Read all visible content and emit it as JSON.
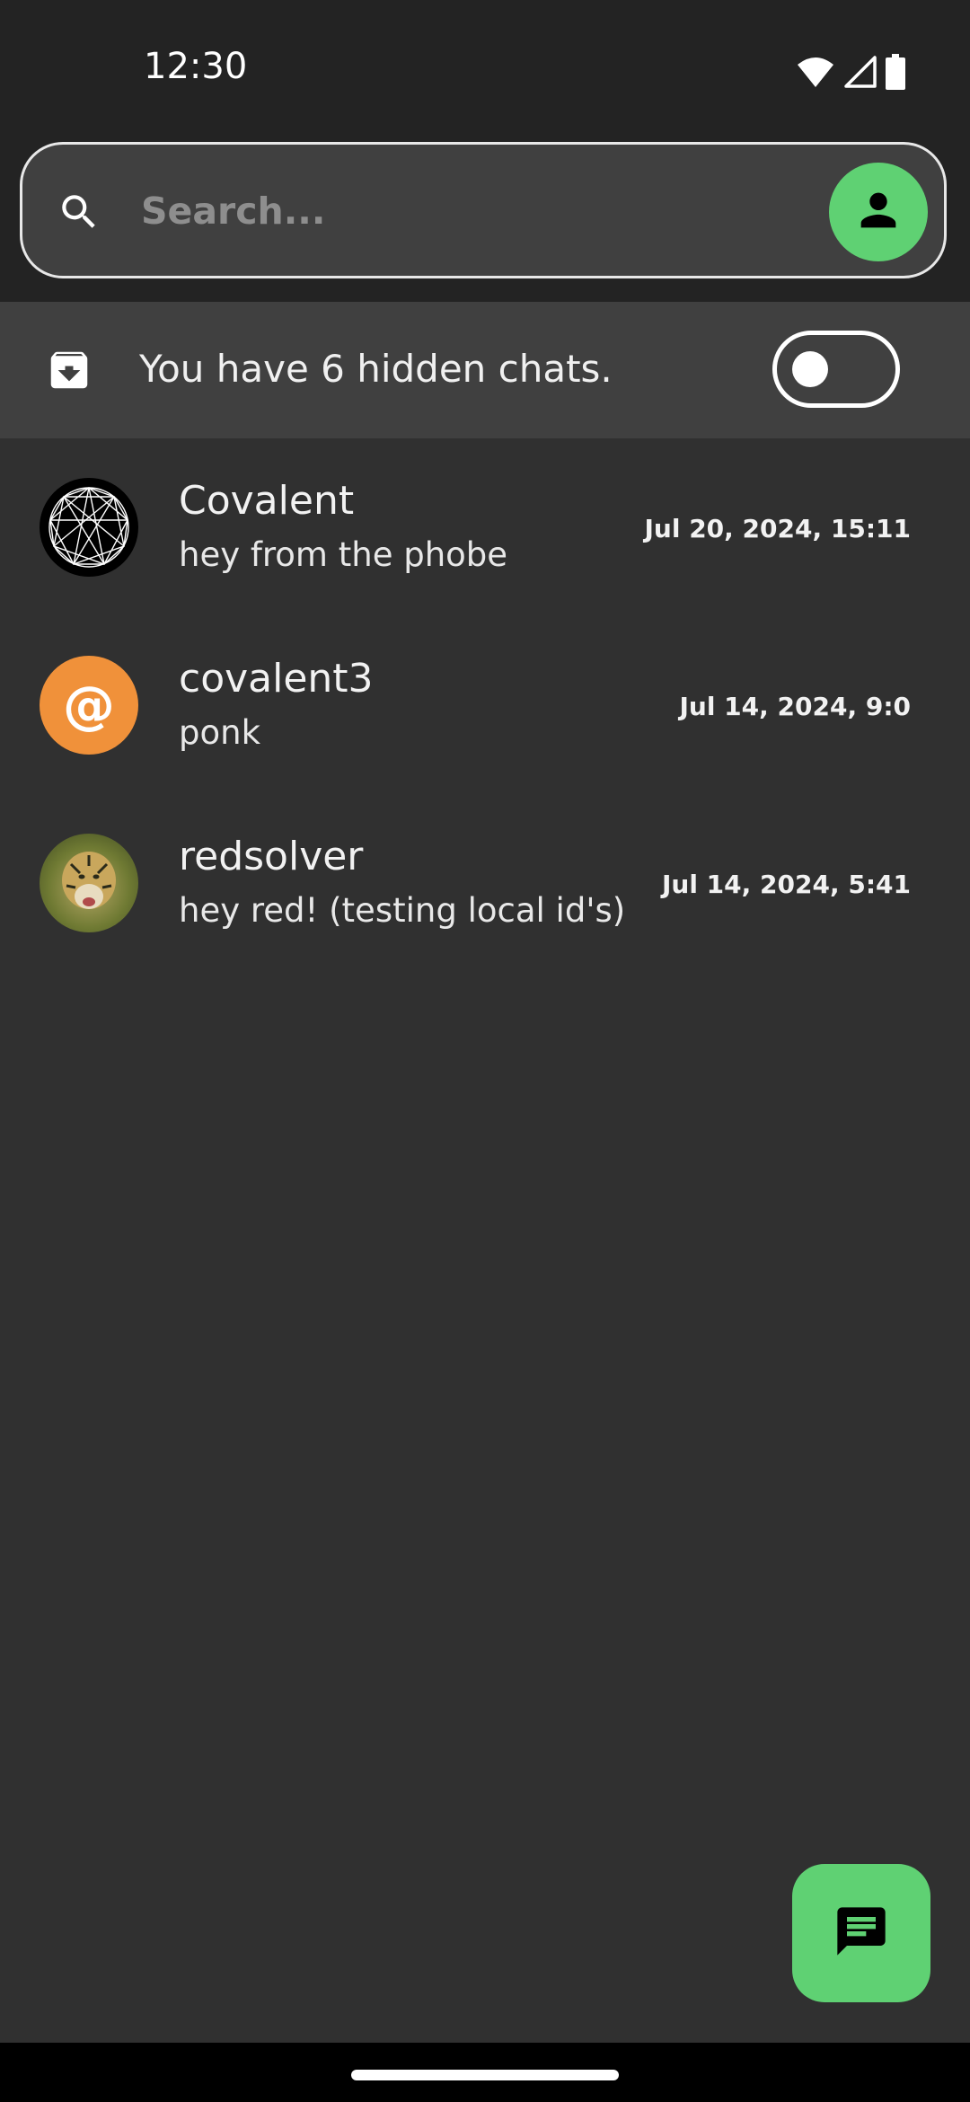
{
  "status_bar": {
    "time": "12:30",
    "icons": [
      "wifi-icon",
      "signal-icon",
      "battery-icon"
    ]
  },
  "search": {
    "placeholder": "Search...",
    "value": "",
    "icon": "search-icon",
    "profile_icon": "person-icon"
  },
  "hidden_chats": {
    "text": "You have 6 hidden chats.",
    "icon": "archive-icon",
    "toggle_on": false
  },
  "chats": [
    {
      "name": "Covalent",
      "message": "hey from the phobe",
      "time": "Jul 20, 2024, 15:11",
      "avatar": "network-graph-icon"
    },
    {
      "name": "covalent3",
      "message": "ponk",
      "time": "Jul 14, 2024, 9:0",
      "avatar": "at-sign",
      "avatar_text": "@"
    },
    {
      "name": "redsolver",
      "message": "hey red! (testing local id's)",
      "time": "Jul 14, 2024, 5:41",
      "avatar": "tiger-photo"
    }
  ],
  "fab": {
    "icon": "chat-icon"
  },
  "colors": {
    "accent": "#5fd173",
    "background": "#303030",
    "header": "#232323",
    "hidden_bar": "#404040",
    "avatar_orange": "#f0913a"
  }
}
